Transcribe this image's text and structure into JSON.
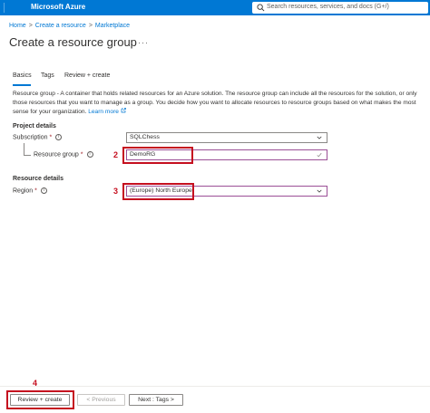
{
  "topbar": {
    "brand": "Microsoft Azure",
    "search_placeholder": "Search resources, services, and docs (G+/)"
  },
  "breadcrumb": {
    "items": [
      "Home",
      "Create a resource",
      "Marketplace"
    ],
    "separator": ">"
  },
  "page": {
    "title": "Create a resource group",
    "more": "···"
  },
  "tabs": [
    {
      "label": "Basics",
      "selected": true
    },
    {
      "label": "Tags",
      "selected": false
    },
    {
      "label": "Review + create",
      "selected": false
    }
  ],
  "description": {
    "text": "Resource group - A container that holds related resources for an Azure solution. The resource group can include all the resources for the solution, or only those resources that you want to manage as a group. You decide how you want to allocate resources to resource groups based on what makes the most sense for your organization.",
    "link": "Learn more"
  },
  "project_details": {
    "heading": "Project details",
    "subscription_label": "Subscription",
    "subscription_value": "SQLChess",
    "resource_group_label": "Resource group",
    "resource_group_value": "DemoRG"
  },
  "resource_details": {
    "heading": "Resource details",
    "region_label": "Region",
    "region_value": "(Europe) North Europe"
  },
  "required_marker": "*",
  "info_glyph": "i",
  "annotations": {
    "step2": "2",
    "step3": "3",
    "step4": "4",
    "color": "#c50f1f"
  },
  "footer": {
    "review_create": "Review + create",
    "previous": "< Previous",
    "next": "Next : Tags >"
  },
  "colors": {
    "azure_blue": "#0078d4",
    "valid_border": "#9b4f96"
  }
}
